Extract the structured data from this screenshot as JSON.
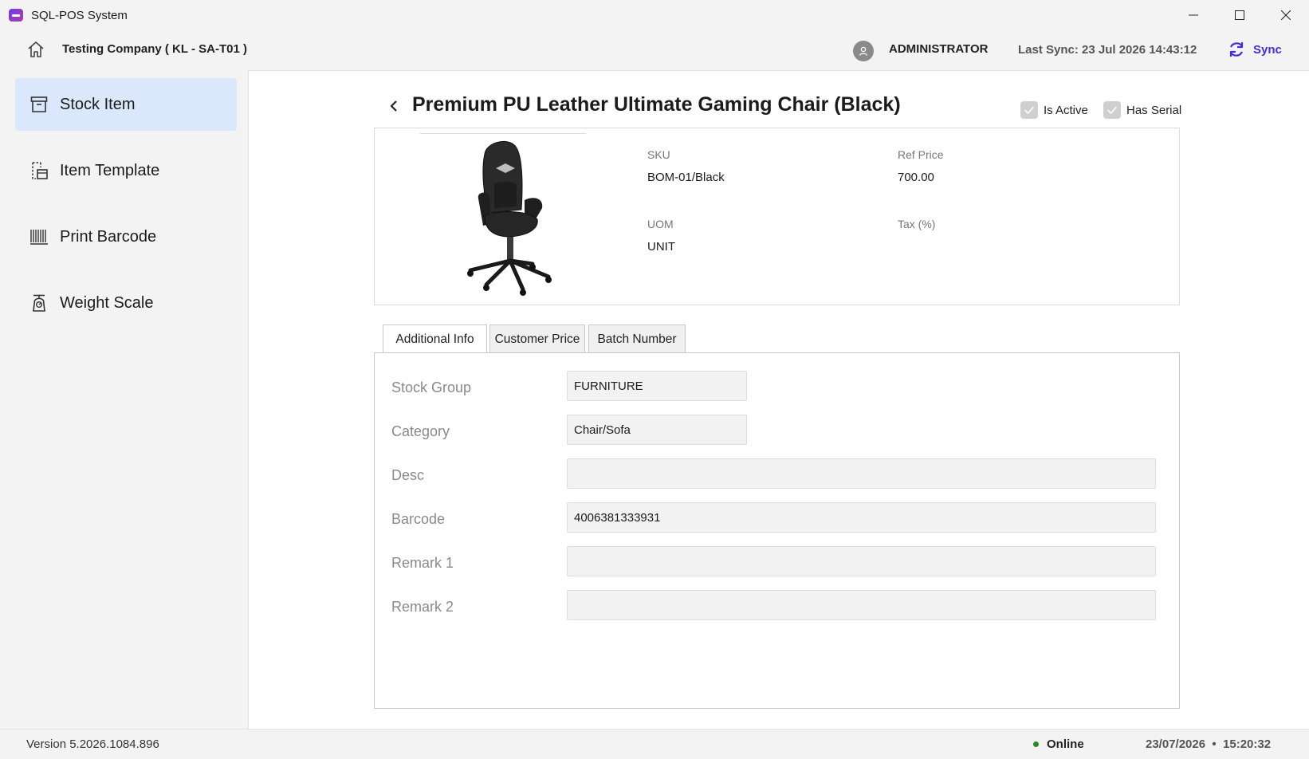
{
  "window": {
    "title": "SQL-POS System"
  },
  "header": {
    "company": "Testing Company ( KL - SA-T01 )",
    "user": "ADMINISTRATOR",
    "last_sync": "Last Sync: 23 Jul 2026 14:43:12",
    "sync_label": "Sync"
  },
  "sidebar": {
    "items": [
      {
        "label": "Stock Item",
        "icon": "archive-box-icon",
        "active": true
      },
      {
        "label": "Item Template",
        "icon": "template-icon",
        "active": false
      },
      {
        "label": "Print Barcode",
        "icon": "barcode-icon",
        "active": false
      },
      {
        "label": "Weight Scale",
        "icon": "weight-scale-icon",
        "active": false
      }
    ]
  },
  "item": {
    "title": "Premium PU Leather Ultimate Gaming Chair (Black)",
    "is_active_label": "Is Active",
    "is_active": true,
    "has_serial_label": "Has Serial",
    "has_serial": true,
    "sku_label": "SKU",
    "sku": "BOM-01/Black",
    "ref_price_label": "Ref Price",
    "ref_price": "700.00",
    "uom_label": "UOM",
    "uom": "UNIT",
    "tax_label": "Tax (%)",
    "tax": ""
  },
  "tabs": [
    {
      "label": "Additional Info",
      "active": true
    },
    {
      "label": "Customer Price",
      "active": false
    },
    {
      "label": "Batch Number",
      "active": false
    }
  ],
  "additional_info": {
    "stock_group": {
      "label": "Stock Group",
      "value": "FURNITURE"
    },
    "category": {
      "label": "Category",
      "value": "Chair/Sofa"
    },
    "desc": {
      "label": "Desc",
      "value": ""
    },
    "barcode": {
      "label": "Barcode",
      "value": "4006381333931"
    },
    "remark1": {
      "label": "Remark 1",
      "value": ""
    },
    "remark2": {
      "label": "Remark 2",
      "value": ""
    }
  },
  "status": {
    "version": "Version 5.2026.1084.896",
    "connection": "Online",
    "date": "23/07/2026",
    "time": "15:20:32",
    "online_color": "#2a8a2a"
  },
  "colors": {
    "accent": "#4a2bd6",
    "active_nav_bg": "#dbe8fb"
  }
}
